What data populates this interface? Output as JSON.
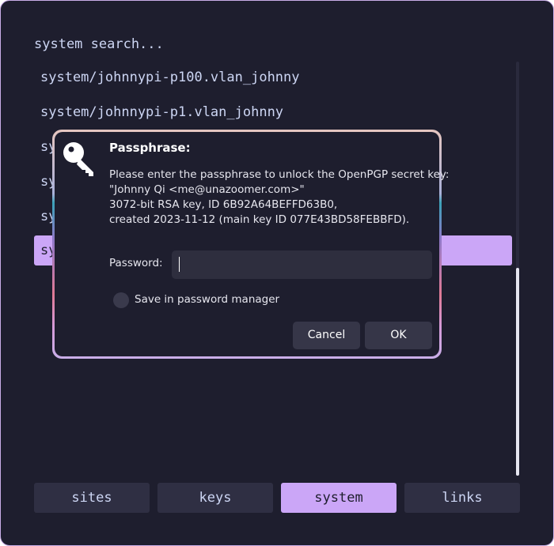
{
  "search": {
    "text": "system search..."
  },
  "results": [
    {
      "label": "system/johnnypi-p100.vlan_johnny"
    },
    {
      "label": "system/johnnypi-p1.vlan_johnny"
    },
    {
      "label": "sy"
    },
    {
      "label": "sy"
    },
    {
      "label": "sy"
    },
    {
      "label": "sy",
      "selected": true
    }
  ],
  "tabs": [
    {
      "label": "sites"
    },
    {
      "label": "keys"
    },
    {
      "label": "system",
      "active": true
    },
    {
      "label": "links"
    }
  ],
  "dialog": {
    "title": "Passphrase:",
    "message": [
      "Please enter the passphrase to unlock the OpenPGP secret key:",
      "\"Johnny Qi <me@unazoomer.com>\"",
      "3072-bit RSA key, ID 6B92A64BEFFD63B0,",
      "created 2023-11-12 (main key ID 077E43BD58FEBBFD)."
    ],
    "password_label": "Password:",
    "password_value": "",
    "save_label": "Save in password manager",
    "save_checked": false,
    "cancel_label": "Cancel",
    "ok_label": "OK",
    "icon": "key-icon"
  },
  "colors": {
    "background": "#1e1e2e",
    "accent": "#cba6f7",
    "text": "#cdd6f4",
    "button": "#363648",
    "window_border": "#c9aee8"
  }
}
